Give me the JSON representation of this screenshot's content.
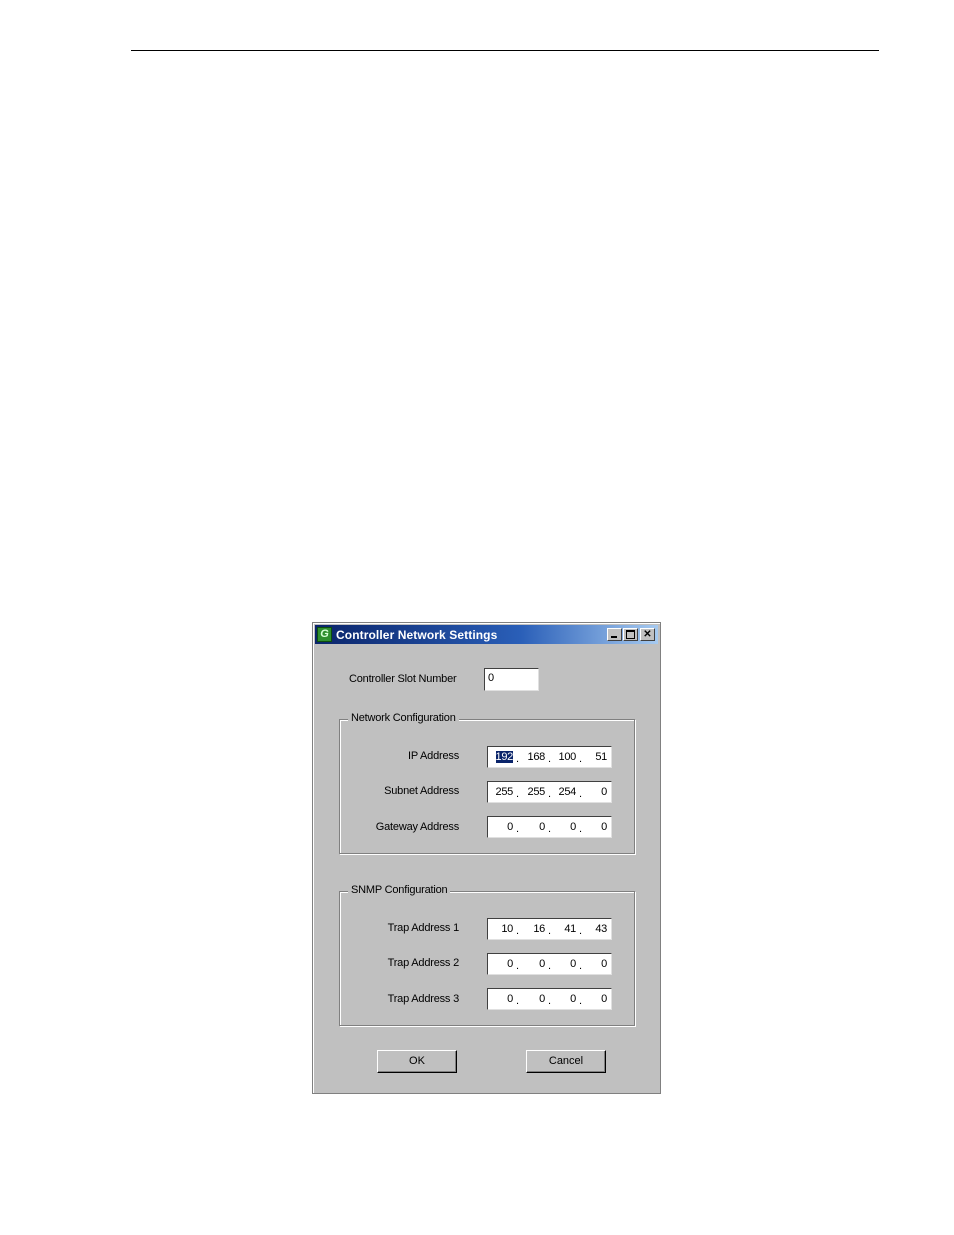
{
  "window": {
    "title": "Controller Network Settings",
    "icon": "grass-valley-g-icon"
  },
  "slot": {
    "label": "Controller Slot Number",
    "value": "0"
  },
  "network": {
    "legend": "Network Configuration",
    "ip": {
      "label": "IP Address",
      "octets": [
        "192",
        "168",
        "100",
        "51"
      ]
    },
    "subnet": {
      "label": "Subnet Address",
      "octets": [
        "255",
        "255",
        "254",
        "0"
      ]
    },
    "gateway": {
      "label": "Gateway Address",
      "octets": [
        "0",
        "0",
        "0",
        "0"
      ]
    }
  },
  "snmp": {
    "legend": "SNMP Configuration",
    "trap1": {
      "label": "Trap Address 1",
      "octets": [
        "10",
        "16",
        "41",
        "43"
      ]
    },
    "trap2": {
      "label": "Trap Address 2",
      "octets": [
        "0",
        "0",
        "0",
        "0"
      ]
    },
    "trap3": {
      "label": "Trap Address 3",
      "octets": [
        "0",
        "0",
        "0",
        "0"
      ]
    }
  },
  "buttons": {
    "ok": "OK",
    "cancel": "Cancel"
  },
  "caption_buttons": {
    "minimize": "minimize-icon",
    "maximize": "maximize-icon",
    "close": "close-icon"
  },
  "colors": {
    "title_start": "#0a246a",
    "title_end": "#a6caf0",
    "face": "#c0c0c0",
    "selection": "#0a246a"
  }
}
